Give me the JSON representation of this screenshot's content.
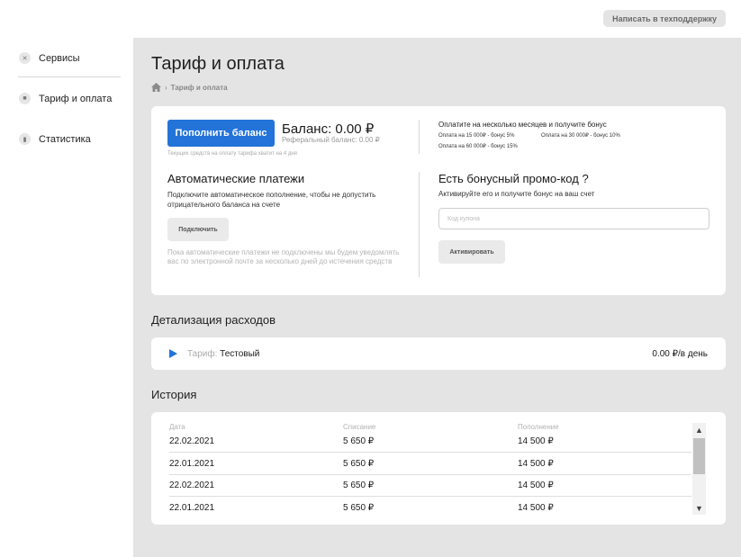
{
  "header": {
    "support_label": "Написать в техподдержку"
  },
  "sidebar": {
    "items": [
      {
        "label": "Сервисы",
        "icon": "tools-icon"
      },
      {
        "label": "Тариф и оплата",
        "icon": "wallet-icon"
      },
      {
        "label": "Статистика",
        "icon": "bar-chart-icon"
      }
    ]
  },
  "page": {
    "title": "Тариф и оплата",
    "breadcrumb": "Тариф и оплата"
  },
  "balance": {
    "topup_label": "Пополнить баланс",
    "balance_text": "Баланс: 0.00 ₽",
    "referral_text": "Реферальный баланс: 0.00 ₽",
    "hint": "Текущих средств на оплату тарифа хватит на 4 дня"
  },
  "bonus": {
    "title": "Оплатите на несколько месяцев и получите бонус",
    "line1": "Оплата на 15 000₽ - бонус 5%",
    "line2": "Оплата на 30 000₽ - бонус 10%",
    "line3": "Оплата на 60 000₽ - бонус 15%"
  },
  "auto": {
    "title": "Автоматические платежи",
    "description": "Подключите автоматическое пополнение, чтобы не допустить отрицательного баланса на счете",
    "connect_label": "Подключить",
    "note": "Пока автоматические платежи не подключены мы будем уведомлять вас по электронной почте за несколько дней до истечения средств"
  },
  "promo": {
    "title": "Есть бонусный промо-код ?",
    "description": "Активируйте его и получите бонус на ваш счет",
    "placeholder": "Код купона",
    "activate_label": "Активировать"
  },
  "expenses": {
    "title": "Детализация расходов",
    "tariff_prefix": "Тариф:",
    "tariff_name": "Тестовый",
    "price": "0.00 ₽/в день"
  },
  "history": {
    "title": "История",
    "columns": [
      "Дата",
      "Списание",
      "Пополнение"
    ],
    "rows": [
      [
        "22.02.2021",
        "5 650 ₽",
        "14 500 ₽"
      ],
      [
        "22.01.2021",
        "5 650 ₽",
        "14 500 ₽"
      ],
      [
        "22.02.2021",
        "5 650 ₽",
        "14 500 ₽"
      ],
      [
        "22.01.2021",
        "5 650 ₽",
        "14 500 ₽"
      ]
    ]
  },
  "colors": {
    "accent": "#2373d9",
    "background": "#e4e4e4"
  }
}
